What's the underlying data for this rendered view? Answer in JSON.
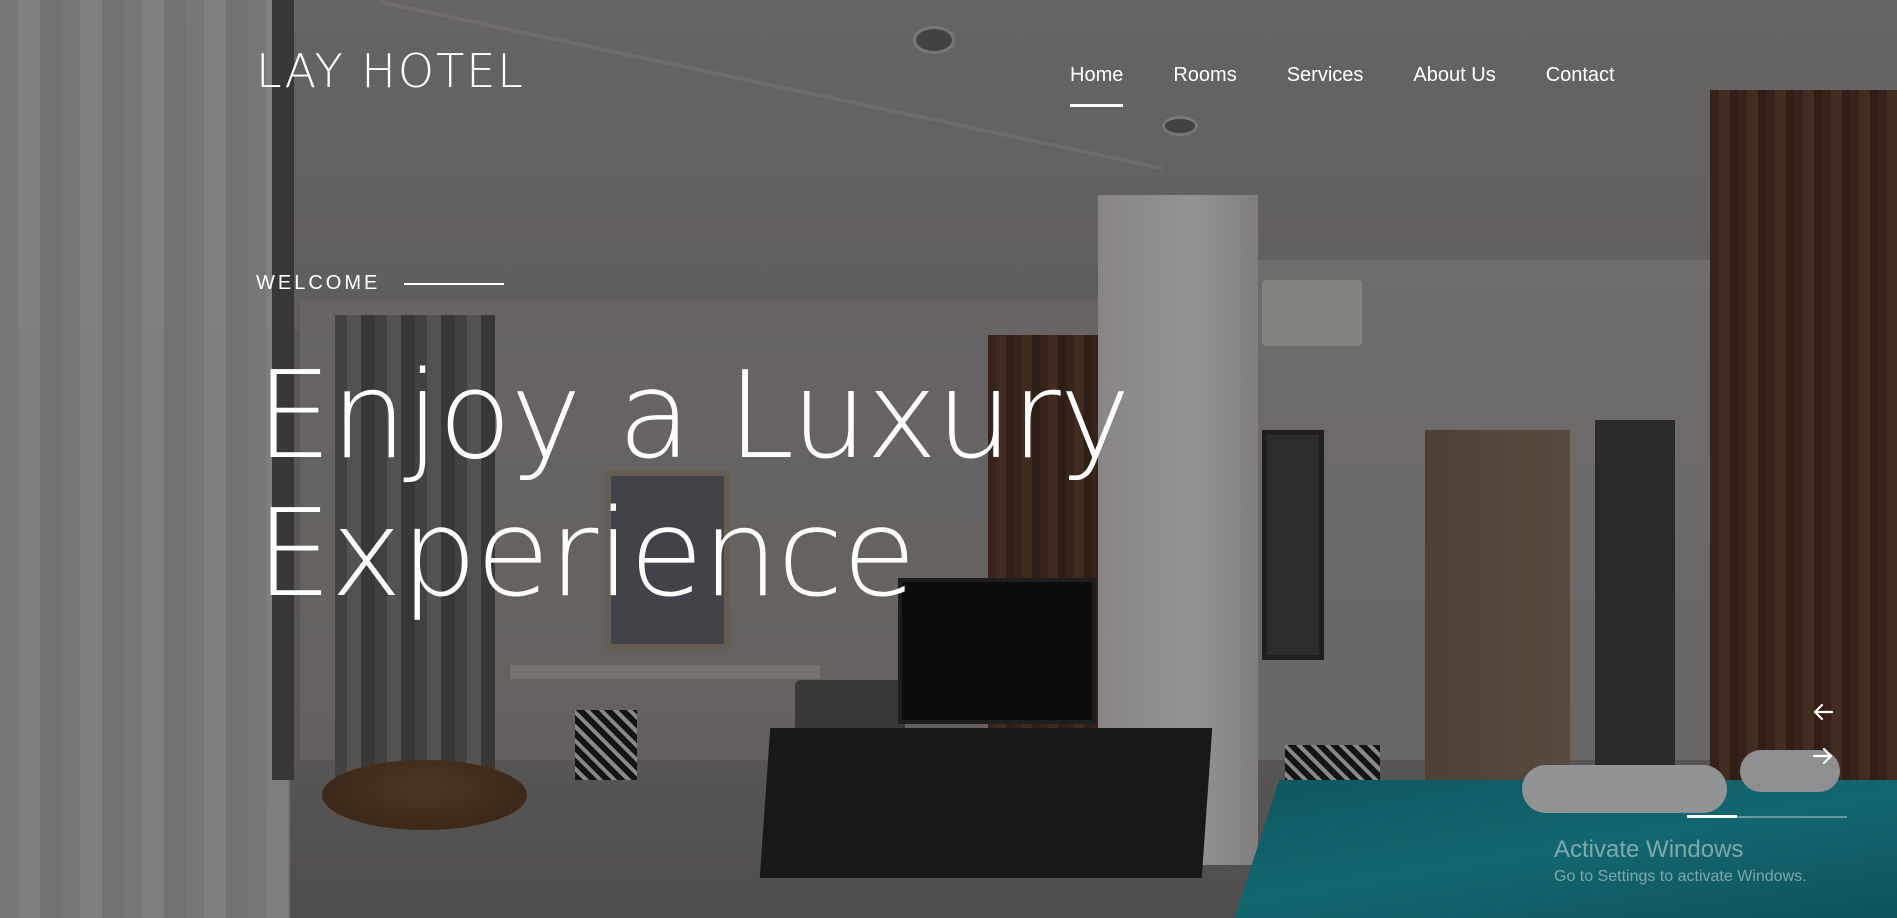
{
  "header": {
    "logo": "LAY HOTEL",
    "nav": [
      {
        "label": "Home",
        "active": true
      },
      {
        "label": "Rooms",
        "active": false
      },
      {
        "label": "Services",
        "active": false
      },
      {
        "label": "About Us",
        "active": false
      },
      {
        "label": "Contact",
        "active": false
      }
    ]
  },
  "hero": {
    "eyebrow": "WELCOME",
    "title_line1": "Enjoy a Luxury",
    "title_line2": "Experience",
    "background": "hotel-bedroom-photo"
  },
  "slider": {
    "prev_icon": "arrow-left-icon",
    "next_icon": "arrow-right-icon",
    "active_slide": 1
  },
  "watermark": {
    "title": "Activate Windows",
    "subtitle": "Go to Settings to activate Windows."
  },
  "colors": {
    "text": "#ffffff",
    "overlay": "rgba(0,0,0,0.28)",
    "bed_accent": "#137a86"
  }
}
